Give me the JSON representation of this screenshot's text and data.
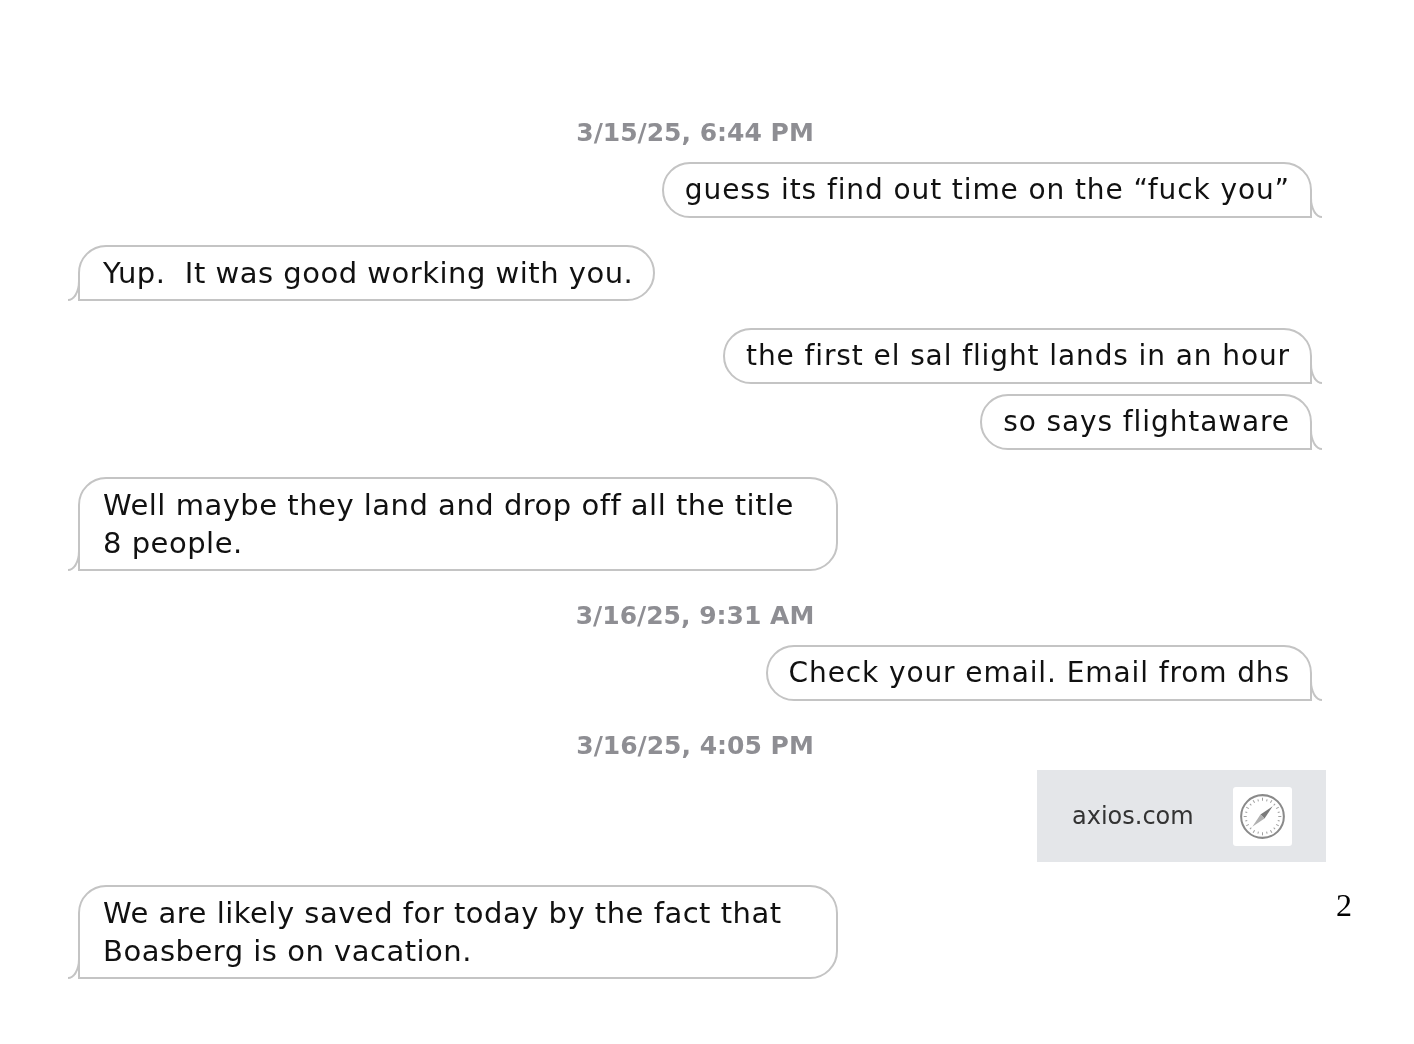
{
  "messages": [
    {
      "kind": "timestamp",
      "text": "3/15/25, 6:44 PM"
    },
    {
      "kind": "outgoing",
      "lines": [
        "guess its find out time on the “fuck you”"
      ]
    },
    {
      "kind": "incoming",
      "lines": [
        "Yup.  It was good working with you."
      ]
    },
    {
      "kind": "outgoing",
      "lines": [
        "the first el sal flight lands in an hour"
      ]
    },
    {
      "kind": "outgoing",
      "lines": [
        "so says flightaware"
      ]
    },
    {
      "kind": "incoming",
      "lines": [
        "Well maybe they land and drop off all the title",
        "8 people."
      ]
    },
    {
      "kind": "timestamp",
      "text": "3/16/25, 9:31 AM"
    },
    {
      "kind": "outgoing",
      "lines": [
        "Check your email. Email from dhs"
      ]
    },
    {
      "kind": "timestamp",
      "text": "3/16/25, 4:05 PM"
    },
    {
      "kind": "link_preview",
      "domain": "axios.com"
    },
    {
      "kind": "incoming",
      "lines": [
        "We are likely saved for today by the fact that",
        "Boasberg is on vacation."
      ]
    }
  ],
  "page_number": "2"
}
